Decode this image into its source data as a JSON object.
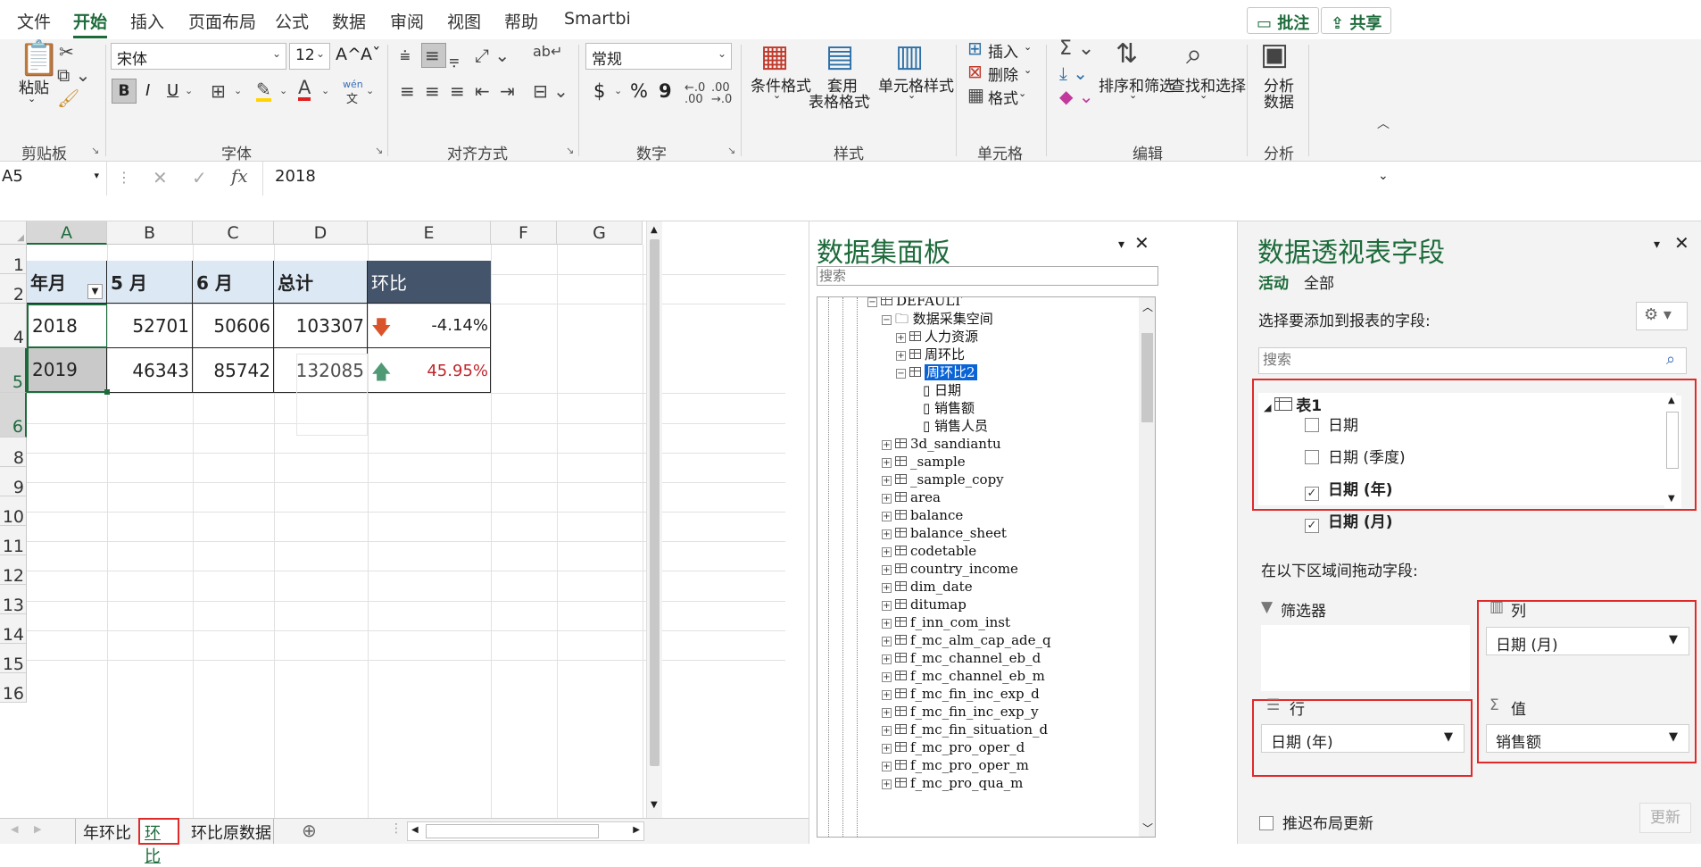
{
  "menu": {
    "tabs": [
      "文件",
      "开始",
      "插入",
      "页面布局",
      "公式",
      "数据",
      "审阅",
      "视图",
      "帮助",
      "Smartbi"
    ],
    "active_tab": "开始",
    "comment_btn": "批注",
    "share_btn": "共享"
  },
  "ribbon": {
    "clipboard": {
      "paste": "粘贴",
      "label": "剪贴板"
    },
    "font": {
      "name": "宋体",
      "size": "12",
      "label": "字体",
      "grow": "A^",
      "shrink": "Aˇ",
      "bold": "B",
      "italic": "I",
      "underline": "U",
      "phonetic": "wén"
    },
    "alignment": {
      "label": "对齐方式"
    },
    "number": {
      "format": "常规",
      "label": "数字",
      "currency": "$",
      "percent": "%",
      "comma": "9"
    },
    "styles": {
      "cond_format": "条件格式",
      "table_format_1": "套用",
      "table_format_2": "表格格式",
      "cell_styles": "单元格样式",
      "label": "样式"
    },
    "cells": {
      "insert": "插入",
      "delete": "删除",
      "format": "格式",
      "label": "单元格"
    },
    "editing": {
      "sort_filter": "排序和筛选",
      "find_select": "查找和选择",
      "label": "编辑"
    },
    "analysis": {
      "analyze_1": "分析",
      "analyze_2": "数据",
      "label": "分析"
    }
  },
  "formula_bar": {
    "name_box": "A5",
    "fx": "fx",
    "value": "2018"
  },
  "sheet": {
    "columns": [
      "A",
      "B",
      "C",
      "D",
      "E",
      "F",
      "G"
    ],
    "rows": [
      "1",
      "2",
      "4",
      "5",
      "6",
      "8",
      "9",
      "10",
      "11",
      "12",
      "13",
      "14",
      "15",
      "16"
    ],
    "header_row": {
      "a": "年月",
      "b": "5 月",
      "c": "6 月",
      "d": "总计",
      "e": "环比"
    },
    "data": [
      {
        "year": "2018",
        "may": "52701",
        "jun": "50606",
        "total": "103307",
        "ratio": "-4.14%",
        "trend": "down"
      },
      {
        "year": "2019",
        "may": "46343",
        "jun": "85742",
        "total": "132085",
        "ratio": "45.95%",
        "trend": "up"
      }
    ],
    "tabs": [
      "年环比",
      "环比",
      "环比原数据"
    ],
    "active_tab": "环比"
  },
  "dataset_panel": {
    "title": "数据集面板",
    "search_placeholder": "搜索",
    "root": "DEFAULT",
    "space": "数据采集空间",
    "space_items": [
      "人力资源",
      "周环比",
      "周环比2"
    ],
    "selected": "周环比2",
    "fields": [
      "日期",
      "销售额",
      "销售人员"
    ],
    "tables": [
      "3d_sandiantu",
      "_sample",
      "_sample_copy",
      "area",
      "balance",
      "balance_sheet",
      "codetable",
      "country_income",
      "dim_date",
      "ditumap",
      "f_inn_com_inst",
      "f_mc_alm_cap_ade_q",
      "f_mc_channel_eb_d",
      "f_mc_channel_eb_m",
      "f_mc_fin_inc_exp_d",
      "f_mc_fin_inc_exp_y",
      "f_mc_fin_situation_d",
      "f_mc_pro_oper_d",
      "f_mc_pro_oper_m",
      "f_mc_pro_qua_m"
    ]
  },
  "pivot_panel": {
    "title": "数据透视表字段",
    "tab_active": "活动",
    "tab_all": "全部",
    "choose_label": "选择要添加到报表的字段:",
    "search_placeholder": "搜索",
    "table_name": "表1",
    "fields": [
      {
        "name": "日期",
        "checked": false
      },
      {
        "name": "日期 (季度)",
        "checked": false
      },
      {
        "name": "日期 (年)",
        "checked": true
      },
      {
        "name": "日期 (月)",
        "checked": true
      }
    ],
    "drag_label": "在以下区域间拖动字段:",
    "filter_label": "筛选器",
    "column_label": "列",
    "column_value": "日期 (月)",
    "row_label": "行",
    "row_value": "日期 (年)",
    "value_label": "值",
    "value_value": "销售额",
    "defer_label": "推迟布局更新",
    "update_btn": "更新"
  },
  "colors": {
    "accent": "#1d6b3b",
    "highlight_red": "#e02a2a",
    "header_fill": "#dce9f5",
    "dark_header": "#44546a",
    "down_arrow": "#d9542b",
    "up_arrow": "#4f9a74"
  }
}
